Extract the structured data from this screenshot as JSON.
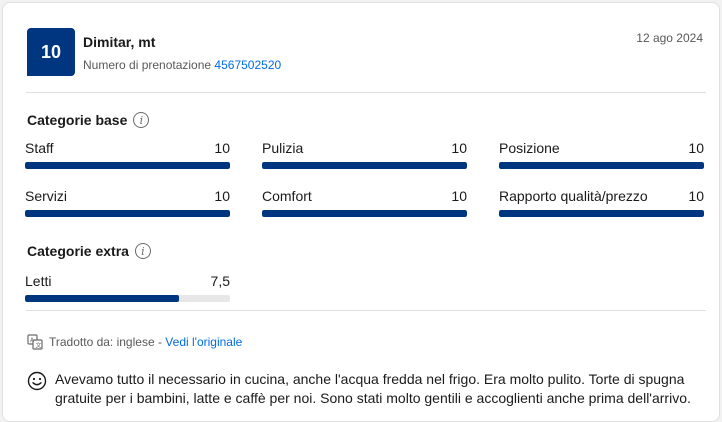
{
  "review": {
    "score": "10",
    "reviewer_name": "Dimitar, mt",
    "booking_label": "Numero di prenotazione",
    "booking_number": "4567502520",
    "date": "12 ago 2024"
  },
  "base_categories": {
    "title": "Categorie base",
    "items": [
      {
        "label": "Staff",
        "value": "10",
        "fraction": 1.0
      },
      {
        "label": "Pulizia",
        "value": "10",
        "fraction": 1.0
      },
      {
        "label": "Posizione",
        "value": "10",
        "fraction": 1.0
      },
      {
        "label": "Servizi",
        "value": "10",
        "fraction": 1.0
      },
      {
        "label": "Comfort",
        "value": "10",
        "fraction": 1.0
      },
      {
        "label": "Rapporto qualità/prezzo",
        "value": "10",
        "fraction": 1.0
      }
    ]
  },
  "extra_categories": {
    "title": "Categorie extra",
    "items": [
      {
        "label": "Letti",
        "value": "7,5",
        "fraction": 0.75
      }
    ]
  },
  "translation": {
    "prefix": "Tradotto da: inglese - ",
    "link": "Vedi l'originale"
  },
  "review_text": "Avevamo tutto il necessario in cucina, anche l'acqua fredda nel frigo. Era molto pulito. Torte di spugna gratuite per i bambini, latte e caffè per noi. Sono stati molto gentili e accoglienti anche prima dell'arrivo.",
  "colors": {
    "brand": "#003580",
    "link": "#006ce4",
    "track": "#e7e7e7"
  },
  "icons": {
    "info": "info-icon",
    "translate": "translate-icon",
    "positive": "smile-icon"
  }
}
